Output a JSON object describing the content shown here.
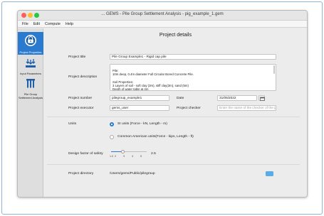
{
  "window": {
    "title": "... GEMS - Pile Group Settlement Analysis - pig_example_1.gem"
  },
  "menu": [
    "File",
    "Edit",
    "Compute",
    "Help"
  ],
  "sidebar": {
    "items": [
      {
        "label": "Project Properties",
        "icon": "project-properties-icon",
        "active": true
      },
      {
        "label": "Input Parameters",
        "icon": "input-parameters-icon",
        "active": false
      },
      {
        "label": "Pile Group Settlement Analysis",
        "icon": "pile-group-icon",
        "active": false
      }
    ]
  },
  "page": {
    "title": "Project details",
    "project_title_label": "Project title",
    "project_title_value": "Pile Group Example1 - Rigid cap pile",
    "project_description_label": "Project description",
    "project_description_value": "Pile:\n10m deep, 0.4m diameter Full Circular Bored Concrete Pile.\n\nSoil Properties:\n3 Layers of soil - soft clay (3m), stiff clay(3m), sand (5m)\nDepth of water table at 4m",
    "project_number_label": "Project number",
    "project_number_value": "pilegroup_example1",
    "date_label": "Date",
    "date_value": "31/05/2022",
    "project_executor_label": "Project executor",
    "project_executor_value": "gems_user",
    "project_checker_label": "Project checker",
    "project_checker_placeholder": "Enter the name of the checker of the p",
    "units_label": "Units",
    "units_options": [
      {
        "label": "SI units (Force - kN, Length - m)",
        "selected": true
      },
      {
        "label": "Common American units(Force - kips, Length - ft)",
        "selected": false
      }
    ],
    "design_factor_label": "Design factor of safety",
    "design_factor_ticks": [
      "1.0",
      "2",
      "3",
      "4",
      "5"
    ],
    "design_factor_value": "2.5",
    "project_directory_label": "Project directory",
    "project_directory_value": "/Users/gems/Public/pilegroup"
  },
  "colors": {
    "accent": "#2a7ad0",
    "directory_button": "#5aabe8"
  }
}
